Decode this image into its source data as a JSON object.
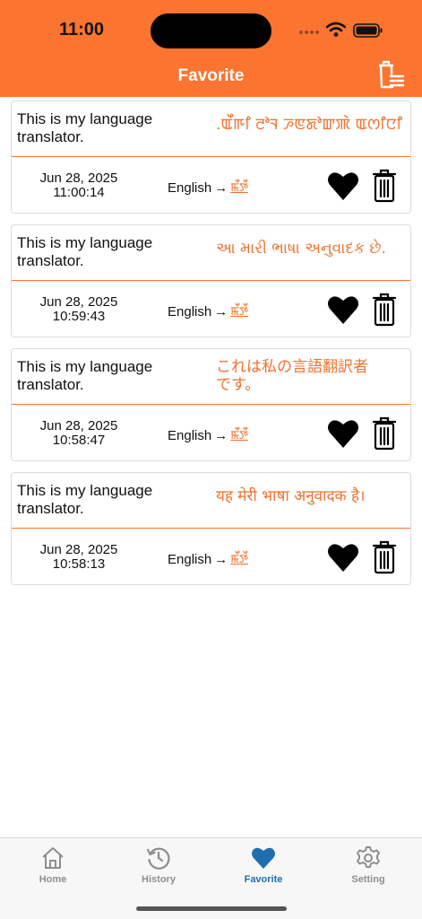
{
  "status": {
    "time": "11:00"
  },
  "header": {
    "title": "Favorite"
  },
  "favorites": [
    {
      "source": "This is my language translator.",
      "target": ".ꯑꯩꯒꯤ ꯂꯣꯜ ꯍꯟꯗꯣꯛꯄꯥ ꯑꯁꯤꯅꯤ",
      "date": "Jun 28, 2025",
      "time": "11:00:14",
      "from_lang": "English",
      "arrow": "→",
      "to_lang": "ꯃꯩꯇꯩ"
    },
    {
      "source": "This is my language translator.",
      "target": "આ મારી ભાષા અનુવાદક છે.",
      "date": "Jun 28, 2025",
      "time": "10:59:43",
      "from_lang": "English",
      "arrow": "→",
      "to_lang": "ꯃꯩꯇꯩ"
    },
    {
      "source": "This is my language translator.",
      "target": "これは私の言語翻訳者です。",
      "date": "Jun 28, 2025",
      "time": "10:58:47",
      "from_lang": "English",
      "arrow": "→",
      "to_lang": "ꯃꯩꯇꯩ"
    },
    {
      "source": "This is my language translator.",
      "target": "यह मेरी भाषा अनुवादक है।",
      "date": "Jun 28, 2025",
      "time": "10:58:13",
      "from_lang": "English",
      "arrow": "→",
      "to_lang": "ꯃꯩꯇꯩ"
    }
  ],
  "tabs": [
    {
      "label": "Home",
      "icon": "home-icon"
    },
    {
      "label": "History",
      "icon": "history-icon"
    },
    {
      "label": "Favorite",
      "icon": "heart-icon",
      "active": true
    },
    {
      "label": "Setting",
      "icon": "gear-icon"
    }
  ],
  "colors": {
    "accent": "#fb7430",
    "tab_active": "#1f6fb0",
    "tab_inactive": "#8e8e8e"
  }
}
